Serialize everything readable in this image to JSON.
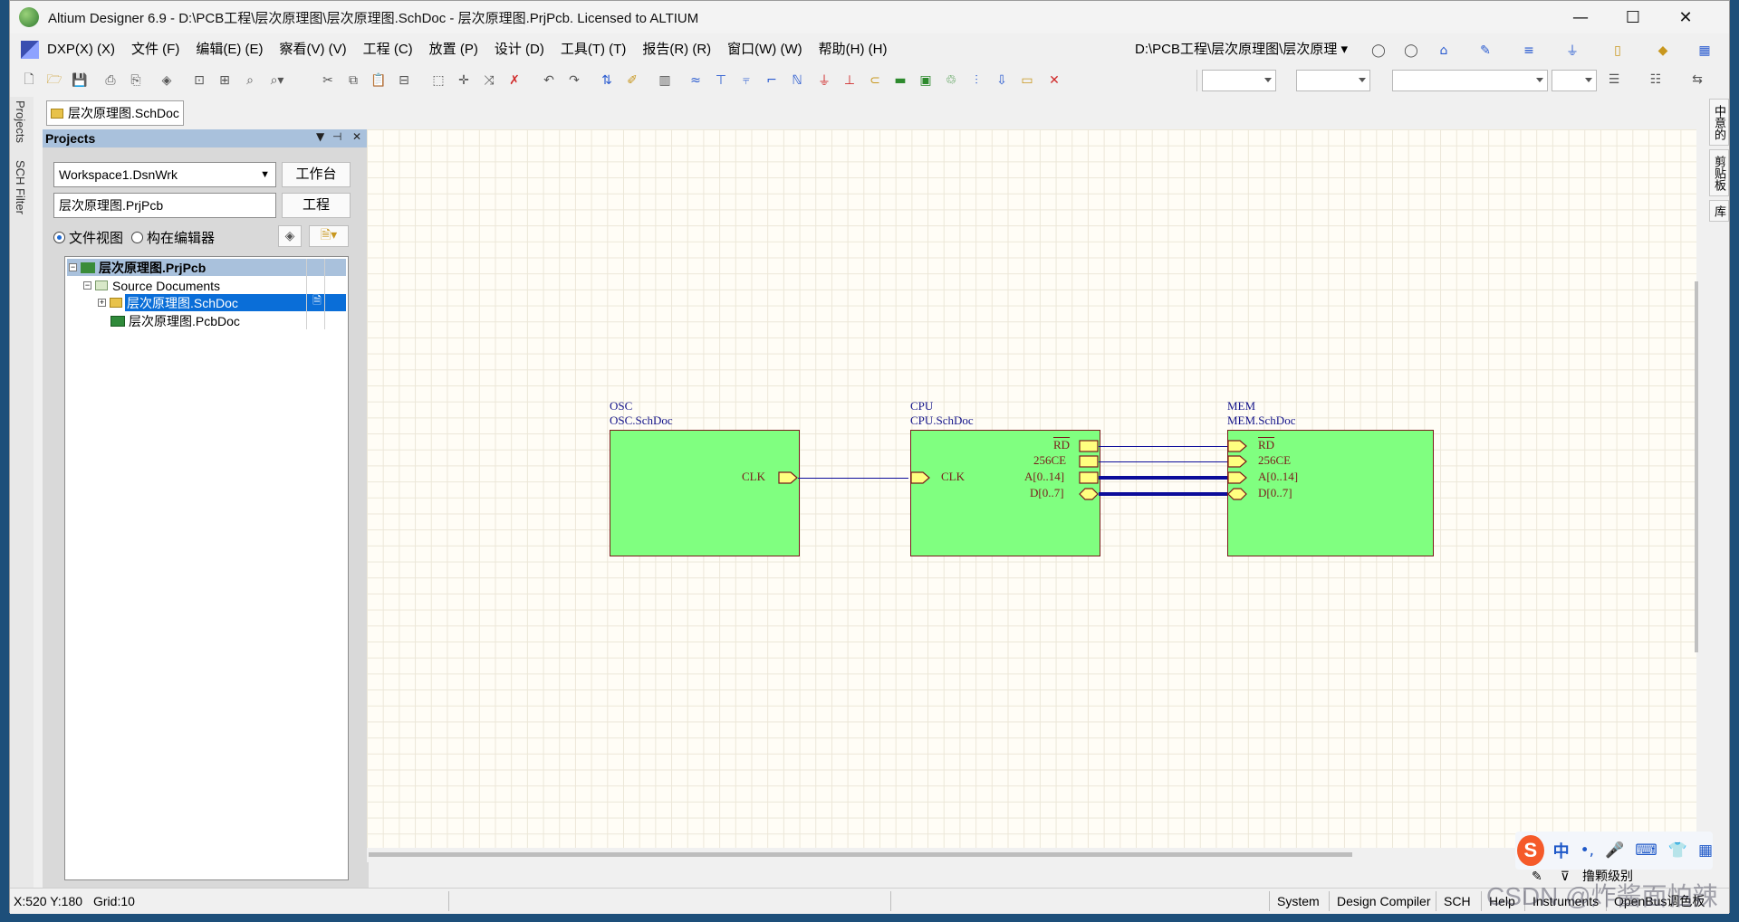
{
  "window": {
    "title": "Altium Designer 6.9 - D:\\PCB工程\\层次原理图\\层次原理图.SchDoc - 层次原理图.PrjPcb. Licensed to ALTIUM",
    "min_glyph": "—",
    "max_glyph": "☐",
    "close_glyph": "✕"
  },
  "menu": [
    "DXP(X) (X)",
    "文件 (F)",
    "编辑(E) (E)",
    "察看(V) (V)",
    "工程 (C)",
    "放置 (P)",
    "设计 (D)",
    "工具(T) (T)",
    "报告(R) (R)",
    "窗口(W) (W)",
    "帮助(H) (H)"
  ],
  "path_selector": "D:\\PCB工程\\层次原理图\\层次原理",
  "left_tabs": [
    "Projects",
    "SCH Filter"
  ],
  "right_tabs": [
    "中意的",
    "剪贴板",
    "库"
  ],
  "document_tab": "层次原理图.SchDoc",
  "panel": {
    "title": "Projects",
    "workspace": "Workspace1.DsnWrk",
    "workspace_button": "工作台",
    "project": "层次原理图.PrjPcb",
    "project_button": "工程",
    "view_file": "文件视图",
    "view_struct": "构在编辑器",
    "tree": {
      "project": "层次原理图.PrjPcb",
      "folder": "Source Documents",
      "doc1": "层次原理图.SchDoc",
      "doc2": "层次原理图.PcbDoc"
    }
  },
  "schematic": {
    "osc": {
      "designator": "OSC",
      "filename": "OSC.SchDoc",
      "entries": [
        "CLK"
      ]
    },
    "cpu": {
      "designator": "CPU",
      "filename": "CPU.SchDoc",
      "entries_left": [
        "CLK"
      ],
      "entries_right": [
        "RD",
        "256CE",
        "A[0..14]",
        "D[0..7]"
      ]
    },
    "mem": {
      "designator": "MEM",
      "filename": "MEM.SchDoc",
      "entries": [
        "RD",
        "256CE",
        "A[0..14]",
        "D[0..7]"
      ]
    },
    "colors": {
      "sheet_fill": "#80ff80",
      "wire": "#0c0c9a",
      "entry_fill": "#ffff80",
      "text": "#7a1a1a",
      "designator": "#14148a"
    }
  },
  "status": {
    "coords": "X:520 Y:180",
    "grid": "Grid:10",
    "tabs": [
      "System",
      "Design Compiler",
      "SCH",
      "Help",
      "Instruments",
      "OpenBus调色板"
    ]
  },
  "ime": {
    "logo": "S",
    "mode": "中",
    "punct": "•,",
    "sub": "撸颗级别"
  },
  "watermark": "CSDN @炸酱面怕辣"
}
